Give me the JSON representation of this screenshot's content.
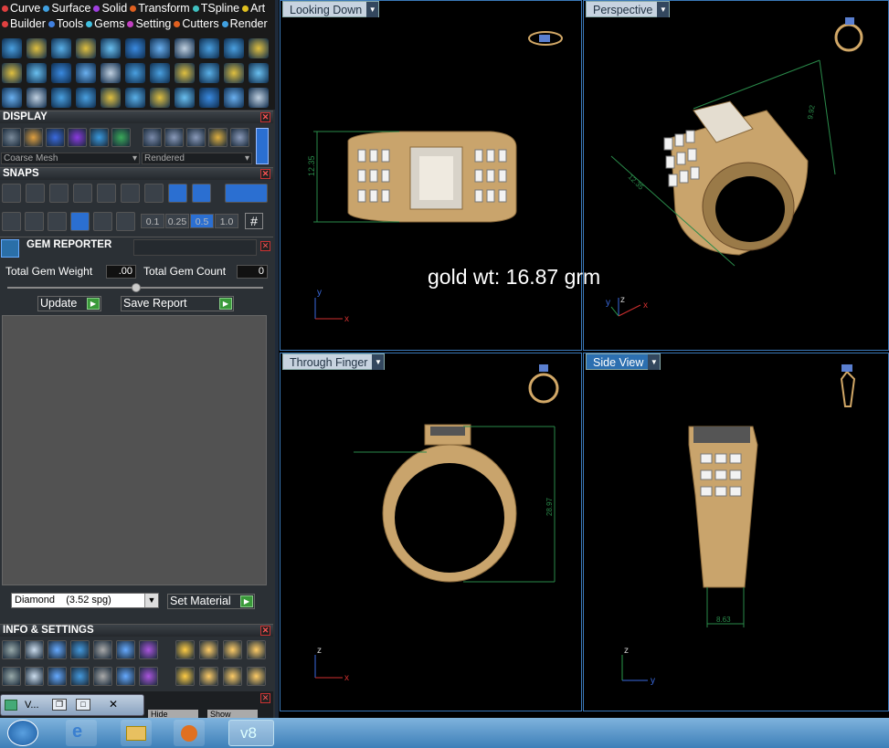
{
  "menu": {
    "row1": [
      {
        "label": "Curve",
        "dot": "#e04040"
      },
      {
        "label": "Surface",
        "dot": "#40a0e0"
      },
      {
        "label": "Solid",
        "dot": "#a040e0"
      },
      {
        "label": "Transform",
        "dot": "#e06020"
      },
      {
        "label": "TSpline",
        "dot": "#40c0c0"
      },
      {
        "label": "Art",
        "dot": "#e0c020"
      }
    ],
    "row2": [
      {
        "label": "Builder",
        "dot": "#e04040"
      },
      {
        "label": "Tools",
        "dot": "#4080e0"
      },
      {
        "label": "Gems",
        "dot": "#40c0e0"
      },
      {
        "label": "Setting",
        "dot": "#c040c0"
      },
      {
        "label": "Cutters",
        "dot": "#e06020"
      },
      {
        "label": "Render",
        "dot": "#40a0e0"
      }
    ]
  },
  "display": {
    "title": "DISPLAY",
    "mesh_select": "Coarse Mesh",
    "render_select": "Rendered"
  },
  "snaps": {
    "title": "SNAPS",
    "steps": [
      "0.1",
      "0.25",
      "0.5",
      "1.0"
    ],
    "active_step": "0.5"
  },
  "gem_reporter": {
    "title": "GEM REPORTER",
    "weight_label": "Total Gem Weight",
    "weight_value": ".00",
    "count_label": "Total Gem Count",
    "count_value": "0",
    "update_label": "Update",
    "save_label": "Save Report",
    "material": "Diamond    (3.52 spg)",
    "set_material_label": "Set Material"
  },
  "info": {
    "title": "INFO & SETTINGS"
  },
  "bottom_panel": {
    "tab": "V...",
    "hide": "Hide",
    "show": "Show"
  },
  "viewports": [
    {
      "label": "Looking Down",
      "axis_h": "x",
      "axis_v": "y",
      "dim": "12.35",
      "active": false
    },
    {
      "label": "Perspective",
      "axis_h": "x",
      "axis_v": "z",
      "dims": [
        "12.35",
        "9.92"
      ],
      "active": false
    },
    {
      "label": "Through Finger",
      "axis_h": "x",
      "axis_v": "z",
      "dim": "28.97",
      "active": false
    },
    {
      "label": "Side View",
      "axis_h": "y",
      "axis_v": "z",
      "dim": "8.63",
      "active": true
    }
  ],
  "perspective_extra_axis": "y",
  "annotation": "gold wt: 16.87 grm",
  "taskbar": {
    "app_label": "v8"
  },
  "colors": {
    "accent": "#2c6fb0",
    "viewport_border": "#3a78b8",
    "gold": "#d2a867"
  }
}
